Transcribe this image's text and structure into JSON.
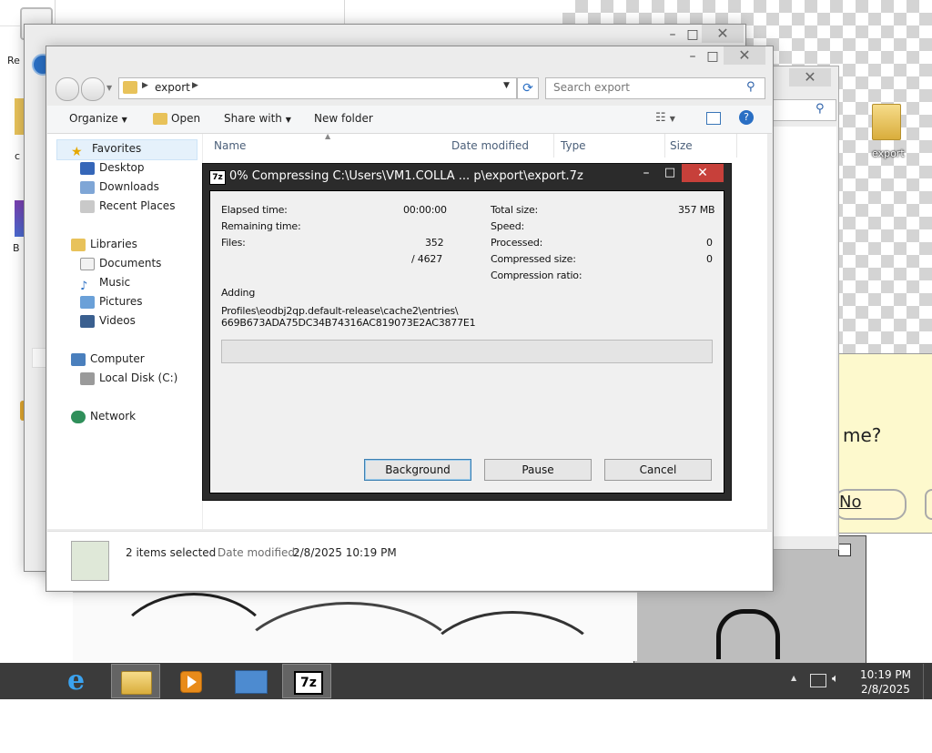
{
  "desktop": {
    "icons": [
      {
        "label": "export"
      }
    ],
    "fragments": {
      "top_left": "Re",
      "left_mid": "c",
      "left_b": "B",
      "dialog_question": "me?",
      "dialog_no": "No"
    }
  },
  "explorer": {
    "breadcrumb": [
      "export"
    ],
    "search_placeholder": "Search export",
    "toolbar": {
      "organize": "Organize",
      "open": "Open",
      "share_with": "Share with",
      "new_folder": "New folder"
    },
    "nav": {
      "favorites": "Favorites",
      "favorites_items": [
        "Desktop",
        "Downloads",
        "Recent Places"
      ],
      "libraries": "Libraries",
      "libraries_items": [
        "Documents",
        "Music",
        "Pictures",
        "Videos"
      ],
      "computer": "Computer",
      "computer_items": [
        "Local Disk (C:)"
      ],
      "network": "Network"
    },
    "columns": [
      "Name",
      "Date modified",
      "Type",
      "Size"
    ],
    "status": {
      "selection": "2 items selected",
      "date_label": "Date modified:",
      "date_value": "2/8/2025 10:19 PM"
    }
  },
  "zip_dialog": {
    "title": "0% Compressing C:\\Users\\VM1.COLLA ... p\\export\\export.7z",
    "left": {
      "elapsed_label": "Elapsed time:",
      "elapsed_value": "00:00:00",
      "remaining_label": "Remaining time:",
      "remaining_value": "",
      "files_label": "Files:",
      "files_value": "352",
      "files_total": "/ 4627"
    },
    "right": {
      "total_size_label": "Total size:",
      "total_size_value": "357 MB",
      "speed_label": "Speed:",
      "speed_value": "",
      "processed_label": "Processed:",
      "processed_value": "0",
      "compressed_label": "Compressed size:",
      "compressed_value": "0",
      "ratio_label": "Compression ratio:",
      "ratio_value": ""
    },
    "action": "Adding",
    "current_file_line1": "Profiles\\eodbj2qp.default-release\\cache2\\entries\\",
    "current_file_line2": "669B673ADA75DC34B74316AC819073E2AC3877E1",
    "progress_fraction": 0,
    "buttons": {
      "background": "Background",
      "pause": "Pause",
      "cancel": "Cancel"
    },
    "icon_text": "7z"
  },
  "taskbar": {
    "zip_icon_text": "7z",
    "clock_time": "10:19 PM",
    "clock_date": "2/8/2025"
  },
  "colors": {
    "close_red": "#c7403a",
    "taskbar": "#3b3b3b",
    "dialog_frame": "#2b2b2b",
    "progress_green": "#06b025"
  }
}
